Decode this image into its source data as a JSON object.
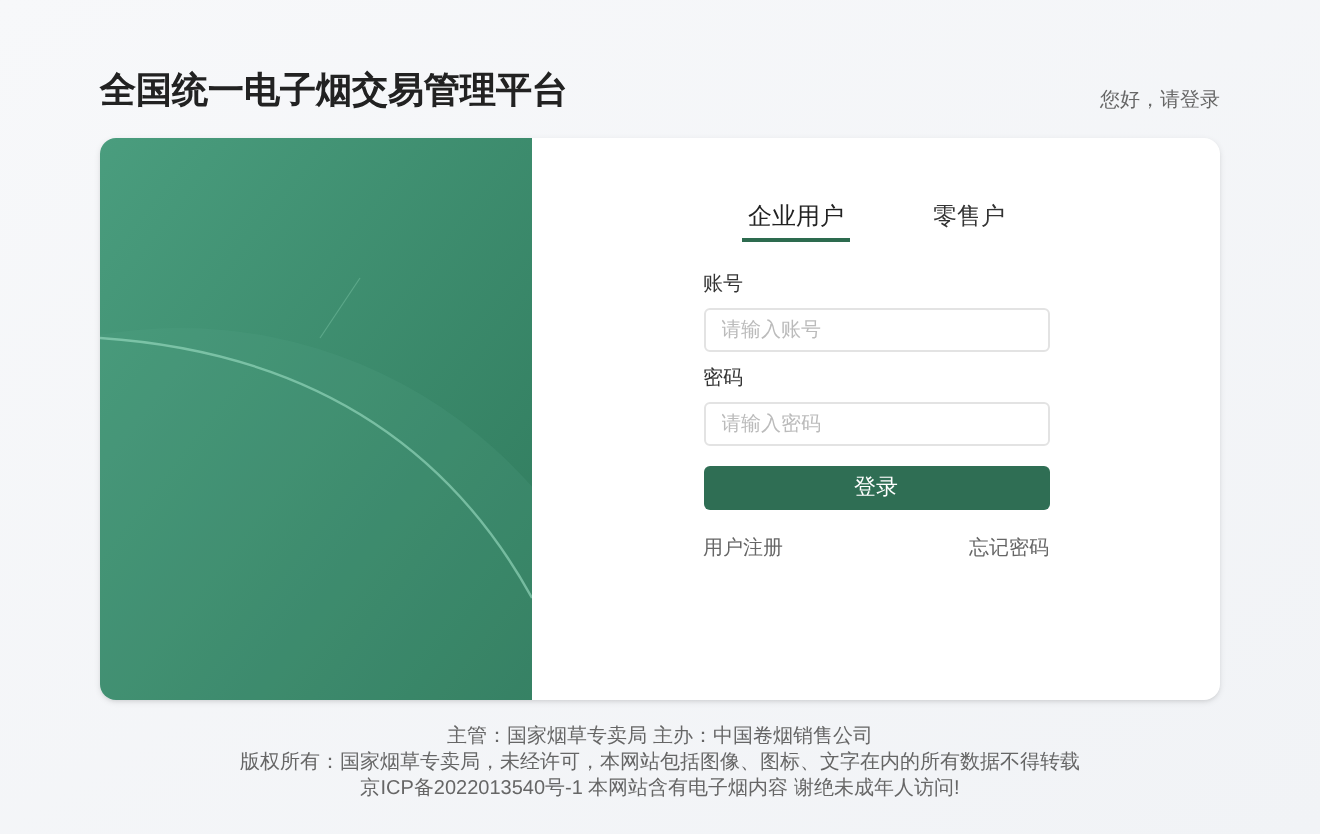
{
  "header": {
    "title": "全国统一电子烟交易管理平台",
    "greeting": "您好，请登录"
  },
  "tabs": [
    {
      "label": "企业用户",
      "selected": true
    },
    {
      "label": "零售户",
      "selected": false
    }
  ],
  "fields": [
    {
      "label": "账号",
      "placeholder": "请输入账号"
    },
    {
      "label": "密码",
      "placeholder": "请输入密码"
    }
  ],
  "login_button": "登录",
  "links": [
    "用户注册",
    "忘记密码"
  ],
  "footer": [
    "主管：国家烟草专卖局 主办：中国卷烟销售公司",
    "版权所有：国家烟草专卖局，未经许可，本网站包括图像、图标、文字在内的所有数据不得转载",
    "京ICP备2022013540号-1 本网站含有电子烟内容 谢绝未成年人访问!"
  ]
}
